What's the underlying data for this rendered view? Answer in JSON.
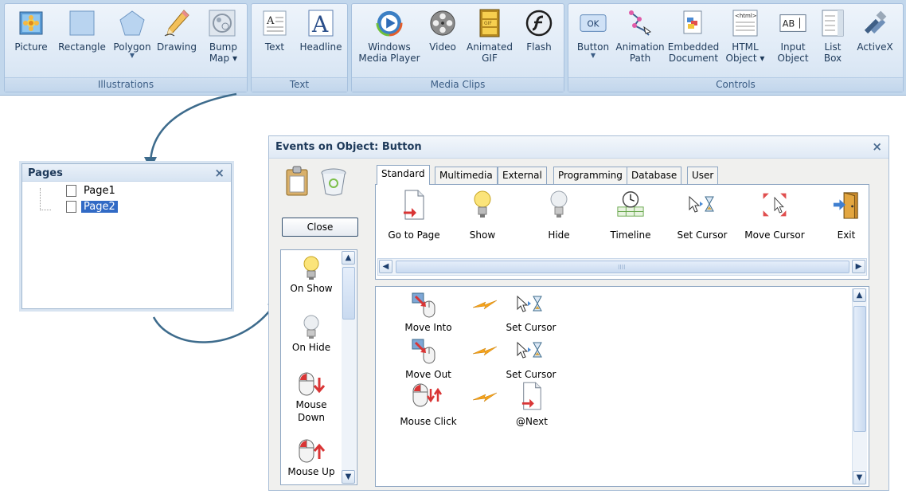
{
  "ribbon": {
    "groups": [
      {
        "caption": "Illustrations",
        "items": [
          {
            "label": "Picture",
            "icon": "picture-icon"
          },
          {
            "label": "Rectangle",
            "icon": "rectangle-icon"
          },
          {
            "label": "Polygon",
            "icon": "polygon-icon",
            "dropdown": true
          },
          {
            "label": "Drawing",
            "icon": "pencil-icon"
          },
          {
            "label": "Bump\nMap",
            "icon": "bump-map-icon",
            "dropdown": true
          }
        ]
      },
      {
        "caption": "Text",
        "items": [
          {
            "label": "Text",
            "icon": "text-icon"
          },
          {
            "label": "Headline",
            "icon": "headline-icon"
          }
        ]
      },
      {
        "caption": "Media Clips",
        "items": [
          {
            "label": "Windows\nMedia Player",
            "icon": "media-player-icon"
          },
          {
            "label": "Video",
            "icon": "video-reel-icon"
          },
          {
            "label": "Animated\nGIF",
            "icon": "gif-icon"
          },
          {
            "label": "Flash",
            "icon": "flash-icon"
          }
        ]
      },
      {
        "caption": "Controls",
        "items": [
          {
            "label": "Button",
            "icon": "ok-button-icon",
            "dropdown": true
          },
          {
            "label": "Animation\nPath",
            "icon": "animation-path-icon"
          },
          {
            "label": "Embedded\nDocument",
            "icon": "embedded-document-icon"
          },
          {
            "label": "HTML\nObject",
            "icon": "html-object-icon",
            "dropdown": true
          },
          {
            "label": "Input\nObject",
            "icon": "input-object-icon"
          },
          {
            "label": "List\nBox",
            "icon": "list-box-icon"
          },
          {
            "label": "ActiveX",
            "icon": "activex-icon"
          }
        ]
      }
    ]
  },
  "pages_panel": {
    "title": "Pages",
    "close": "×",
    "pages": [
      {
        "label": "Page1",
        "selected": false
      },
      {
        "label": "Page2",
        "selected": true
      }
    ]
  },
  "events_dialog": {
    "title": "Events on Object: Button",
    "close": "×",
    "close_button": "Close",
    "tabs": [
      "Standard",
      "Multimedia",
      "External",
      "Programming",
      "Database",
      "User"
    ],
    "active_tab": "Standard",
    "actions": [
      {
        "label": "Go to Page",
        "icon": "go-to-page-icon"
      },
      {
        "label": "Show",
        "icon": "lightbulb-on-icon"
      },
      {
        "label": "Hide",
        "icon": "lightbulb-off-icon"
      },
      {
        "label": "Timeline",
        "icon": "timeline-icon"
      },
      {
        "label": "Set Cursor",
        "icon": "set-cursor-icon"
      },
      {
        "label": "Move Cursor",
        "icon": "move-cursor-icon"
      },
      {
        "label": "Exit",
        "icon": "exit-door-icon"
      }
    ],
    "triggers": [
      {
        "label": "On Show",
        "icon": "lightbulb-on-icon"
      },
      {
        "label": "On Hide",
        "icon": "lightbulb-off-icon"
      },
      {
        "label": "Mouse\nDown",
        "icon": "mouse-down-icon"
      },
      {
        "label": "Mouse Up",
        "icon": "mouse-up-icon"
      }
    ],
    "assigned_events": [
      {
        "event": "Move Into",
        "action": "Set Cursor"
      },
      {
        "event": "Move Out",
        "action": "Set Cursor"
      },
      {
        "event": "Mouse Click",
        "action": "@Next"
      }
    ],
    "grip": "IIII"
  },
  "colors": {
    "ribbon_bg": "#c2d7ec",
    "selection": "#316ac5",
    "connector": "#3d6b8c"
  }
}
